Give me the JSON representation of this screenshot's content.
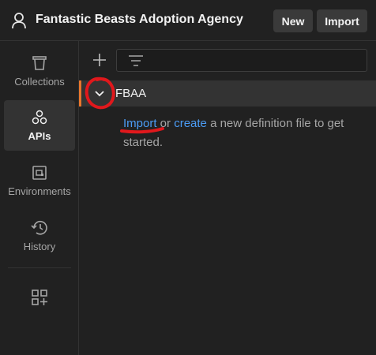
{
  "workspace": {
    "title": "Fantastic Beasts Adoption Agency",
    "icon": "person-icon"
  },
  "header": {
    "new_label": "New",
    "import_label": "Import"
  },
  "sidebar": {
    "items": [
      {
        "label": "Collections",
        "icon": "trash-can-icon",
        "active": false
      },
      {
        "label": "APIs",
        "icon": "apis-icon",
        "active": true
      },
      {
        "label": "Environments",
        "icon": "environment-icon",
        "active": false
      },
      {
        "label": "History",
        "icon": "history-icon",
        "active": false
      }
    ],
    "extra_icon": "add-tile-icon"
  },
  "toolbar": {
    "add_icon": "plus-icon",
    "filter_icon": "filter-icon"
  },
  "api": {
    "name": "FBAA",
    "expanded": true,
    "empty_state": {
      "import_link": "Import",
      "or_text": " or ",
      "create_link": "create",
      "rest_text": " a new definition file to get started."
    }
  },
  "colors": {
    "background": "#212121",
    "selected_row": "#333333",
    "accent_orange": "#e8762c",
    "link_blue": "#4b9cf5",
    "annotation_red": "#e0181c"
  }
}
